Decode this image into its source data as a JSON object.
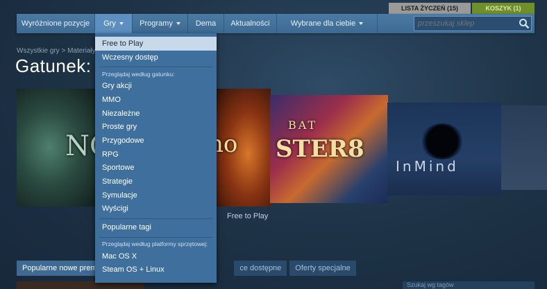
{
  "topbar": {
    "wishlist_label": "LISTA ŻYCZEŃ (15)",
    "cart_label": "KOSZYK (1)"
  },
  "nav": {
    "items": [
      {
        "label": "Wyróżnione pozycje"
      },
      {
        "label": "Gry"
      },
      {
        "label": "Programy"
      },
      {
        "label": "Dema"
      },
      {
        "label": "Aktualności"
      },
      {
        "label": "Wybrane dla ciebie"
      }
    ],
    "search_placeholder": "przeszukaj sklep"
  },
  "breadcrumb": "Wszystkie gry > Materiały",
  "page_title": "Gatunek:",
  "carousel": {
    "caption": "Free to Play",
    "tiles": [
      {
        "text": "NO"
      },
      {
        "text": "ho"
      },
      {
        "text": "BAT"
      },
      {
        "text": "STER8"
      },
      {
        "text": "InMind"
      }
    ]
  },
  "dropdown": {
    "top_items": [
      {
        "label": "Free to Play"
      },
      {
        "label": "Wczesny dostęp"
      }
    ],
    "genre_heading": "Przeglądaj według gatunku:",
    "genres": [
      {
        "label": "Gry akcji"
      },
      {
        "label": "MMO"
      },
      {
        "label": "Niezależne"
      },
      {
        "label": "Proste gry"
      },
      {
        "label": "Przygodowe"
      },
      {
        "label": "RPG"
      },
      {
        "label": "Sportowe"
      },
      {
        "label": "Strategie"
      },
      {
        "label": "Symulacje"
      },
      {
        "label": "Wyścigi"
      }
    ],
    "tags_label": "Popularne tagi",
    "platform_heading": "Przeglądaj według platformy sprzętowej:",
    "platforms": [
      {
        "label": "Mac OS X"
      },
      {
        "label": "Steam OS + Linux"
      }
    ]
  },
  "tabs": [
    {
      "label": "Popularne nowe premiery"
    },
    {
      "label": "ce dostępne"
    },
    {
      "label": "Oferty specjalne"
    }
  ],
  "filter_label": "Szukaj wg tagów"
}
